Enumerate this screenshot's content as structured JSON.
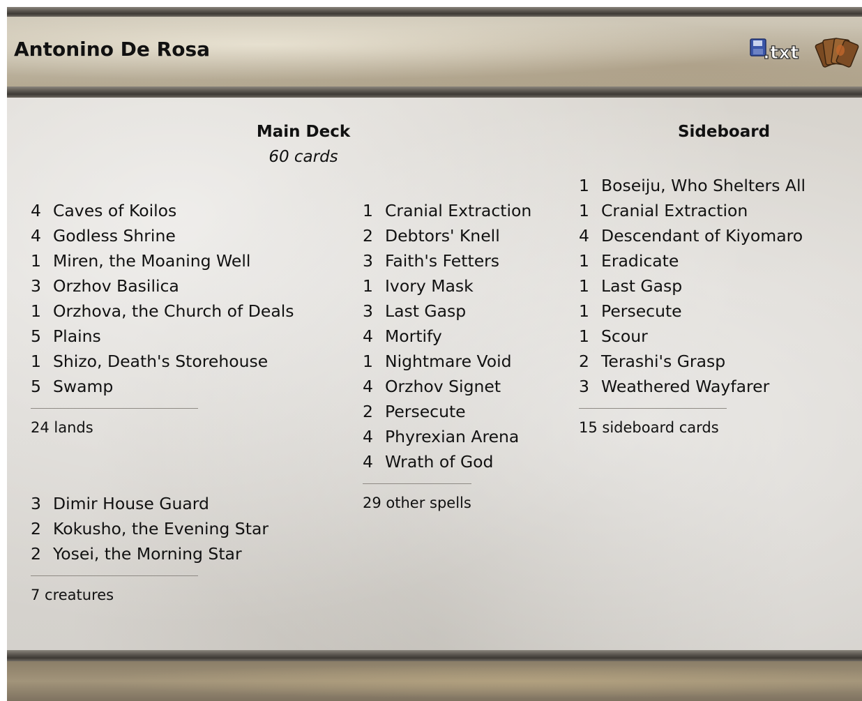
{
  "player": {
    "name": "Antonino De Rosa"
  },
  "header_icons": {
    "txt_label": ".txt",
    "deck_icon": "deck-cards-icon"
  },
  "main_deck": {
    "title": "Main Deck",
    "count_label": "60 cards",
    "lands": [
      {
        "qty": "4",
        "name": "Caves of Koilos"
      },
      {
        "qty": "4",
        "name": "Godless Shrine"
      },
      {
        "qty": "1",
        "name": "Miren, the Moaning Well"
      },
      {
        "qty": "3",
        "name": "Orzhov Basilica"
      },
      {
        "qty": "1",
        "name": "Orzhova, the Church of Deals"
      },
      {
        "qty": "5",
        "name": "Plains"
      },
      {
        "qty": "1",
        "name": "Shizo, Death's Storehouse"
      },
      {
        "qty": "5",
        "name": "Swamp"
      }
    ],
    "lands_total": "24 lands",
    "creatures": [
      {
        "qty": "3",
        "name": "Dimir House Guard"
      },
      {
        "qty": "2",
        "name": "Kokusho, the Evening Star"
      },
      {
        "qty": "2",
        "name": "Yosei, the Morning Star"
      }
    ],
    "creatures_total": "7 creatures",
    "spells": [
      {
        "qty": "1",
        "name": "Cranial Extraction"
      },
      {
        "qty": "2",
        "name": "Debtors' Knell"
      },
      {
        "qty": "3",
        "name": "Faith's Fetters"
      },
      {
        "qty": "1",
        "name": "Ivory Mask"
      },
      {
        "qty": "3",
        "name": "Last Gasp"
      },
      {
        "qty": "4",
        "name": "Mortify"
      },
      {
        "qty": "1",
        "name": "Nightmare Void"
      },
      {
        "qty": "4",
        "name": "Orzhov Signet"
      },
      {
        "qty": "2",
        "name": "Persecute"
      },
      {
        "qty": "4",
        "name": "Phyrexian Arena"
      },
      {
        "qty": "4",
        "name": "Wrath of God"
      }
    ],
    "spells_total": "29 other spells"
  },
  "sideboard": {
    "title": "Sideboard",
    "cards": [
      {
        "qty": "1",
        "name": "Boseiju, Who Shelters All"
      },
      {
        "qty": "1",
        "name": "Cranial Extraction"
      },
      {
        "qty": "4",
        "name": "Descendant of Kiyomaro"
      },
      {
        "qty": "1",
        "name": "Eradicate"
      },
      {
        "qty": "1",
        "name": "Last Gasp"
      },
      {
        "qty": "1",
        "name": "Persecute"
      },
      {
        "qty": "1",
        "name": "Scour"
      },
      {
        "qty": "2",
        "name": "Terashi's Grasp"
      },
      {
        "qty": "3",
        "name": "Weathered Wayfarer"
      }
    ],
    "total": "15 sideboard cards"
  }
}
